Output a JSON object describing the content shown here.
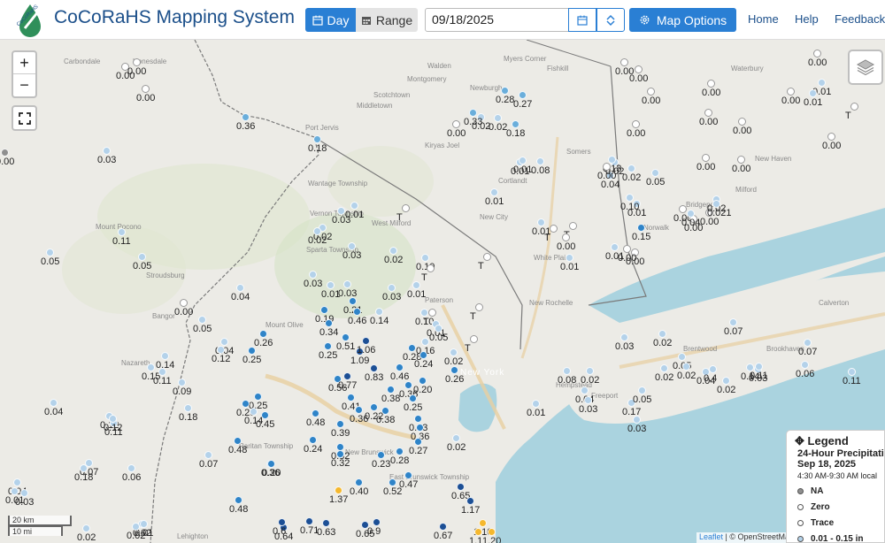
{
  "header": {
    "title": "CoCoRaHS Mapping System",
    "logo_text": "CoCoRaHS",
    "day_label": "Day",
    "range_label": "Range",
    "date_value": "09/18/2025",
    "map_options_label": "Map Options",
    "nav": [
      "Home",
      "Help",
      "Feedback"
    ]
  },
  "colors": {
    "accent": "#2a7fd4",
    "brand": "#1b4f8a",
    "na": "#8f8f8f",
    "zero": "#ffffff",
    "trace": "#ffffff",
    "light": "#b4d2ea",
    "low": "#6aaedb",
    "mid": "#2f84c8",
    "high": "#1c4f95",
    "heavy": "#f5b82e"
  },
  "map": {
    "zoom_in": "+",
    "zoom_out": "−",
    "scale_km": "20 km",
    "scale_mi": "10 mi",
    "attribution_leaflet": "Leaflet",
    "attribution_rest": " | © OpenStreetMap",
    "places": [
      "Carbondale",
      "Honesdale",
      "Walden",
      "Montgomery",
      "Middletown",
      "Scotchtown",
      "Port Jervis",
      "Kiryas Joel",
      "Newburgh",
      "Fishkill",
      "Myers Corner",
      "Waterbury",
      "New Haven",
      "Milford",
      "Wantage Township",
      "Vernon Township",
      "West Milford",
      "Sparta Township",
      "Cortlandt",
      "Somers",
      "New City",
      "White Plains",
      "Norwalk",
      "Stroudsburg",
      "Mount Olive",
      "Bangor",
      "Nazareth",
      "Paterson",
      "New Rochelle",
      "New York",
      "Raritan Township",
      "New Brunswick",
      "East Brunswick Township",
      "Brentwood",
      "Brookhaven",
      "Calverton",
      "Freeport",
      "Hempstead",
      "Mount Pocono",
      "Bridgeport",
      "Lehighton"
    ],
    "stations": [
      {
        "v": "0.00",
        "c": "na"
      },
      {
        "v": "0.00",
        "c": "zero"
      },
      {
        "v": "0.00",
        "c": "zero"
      },
      {
        "v": "0.00",
        "c": "zero"
      },
      {
        "v": "0.36",
        "c": "low"
      },
      {
        "v": "0.03",
        "c": "light"
      },
      {
        "v": "0.00",
        "c": "zero"
      },
      {
        "v": "0.18",
        "c": "low"
      },
      {
        "v": "0.02",
        "c": "light"
      },
      {
        "v": "0.00",
        "c": "zero"
      },
      {
        "v": "0.01",
        "c": "light"
      },
      {
        "v": "0.33",
        "c": "low"
      },
      {
        "v": "0.02",
        "c": "light"
      },
      {
        "v": "0.28",
        "c": "low"
      },
      {
        "v": "0.27",
        "c": "low"
      },
      {
        "v": "0.18",
        "c": "low"
      },
      {
        "v": "0.00",
        "c": "zero"
      },
      {
        "v": "0.00",
        "c": "zero"
      },
      {
        "v": "0.00",
        "c": "zero"
      },
      {
        "v": "0.00",
        "c": "zero"
      },
      {
        "v": "0.01",
        "c": "light"
      },
      {
        "v": "0.01",
        "c": "light"
      },
      {
        "v": "T",
        "c": "trace"
      },
      {
        "v": "0.00",
        "c": "zero"
      },
      {
        "v": "0.00",
        "c": "zero"
      },
      {
        "v": "0.00",
        "c": "zero"
      },
      {
        "v": "0.00",
        "c": "zero"
      },
      {
        "v": "0.00",
        "c": "zero"
      },
      {
        "v": "0.00",
        "c": "zero"
      },
      {
        "v": "0.01",
        "c": "light"
      },
      {
        "v": "0.08",
        "c": "light"
      },
      {
        "v": "0.04",
        "c": "light"
      },
      {
        "v": "0.02",
        "c": "light"
      },
      {
        "v": "0.02",
        "c": "light"
      },
      {
        "v": "0.01",
        "c": "light"
      },
      {
        "v": "0.00",
        "c": "zero"
      },
      {
        "v": "0.00",
        "c": "zero"
      },
      {
        "v": "0.00",
        "c": "zero"
      },
      {
        "v": "0.01",
        "c": "light"
      },
      {
        "v": "0.03",
        "c": "light"
      },
      {
        "v": "0.02",
        "c": "light"
      },
      {
        "v": "0.03",
        "c": "light"
      },
      {
        "v": "T",
        "c": "trace"
      },
      {
        "v": "0.01",
        "c": "light"
      },
      {
        "v": "0.10",
        "c": "light"
      },
      {
        "v": "0.02",
        "c": "light"
      },
      {
        "v": "0.021",
        "c": "light"
      },
      {
        "v": "0.00",
        "c": "zero"
      },
      {
        "v": "0.15",
        "c": "mid"
      },
      {
        "v": "0.01",
        "c": "light"
      },
      {
        "v": "T",
        "c": "trace"
      },
      {
        "v": "T",
        "c": "trace"
      },
      {
        "v": "0.01",
        "c": "light"
      },
      {
        "v": "0.00",
        "c": "zero"
      },
      {
        "v": "0.11",
        "c": "light"
      },
      {
        "v": "0.05",
        "c": "light"
      },
      {
        "v": "0.05",
        "c": "light"
      },
      {
        "v": "0.02",
        "c": "light"
      },
      {
        "v": "0.03",
        "c": "light"
      },
      {
        "v": "0.02",
        "c": "light"
      },
      {
        "v": "0.10",
        "c": "light"
      },
      {
        "v": "T",
        "c": "trace"
      },
      {
        "v": "T",
        "c": "trace"
      },
      {
        "v": "0.04",
        "c": "light"
      },
      {
        "v": "0.03",
        "c": "light"
      },
      {
        "v": "0.01",
        "c": "light"
      },
      {
        "v": "0.01",
        "c": "light"
      },
      {
        "v": "0.03",
        "c": "light"
      },
      {
        "v": "0.00",
        "c": "zero"
      },
      {
        "v": "0.05",
        "c": "light"
      },
      {
        "v": "0.19",
        "c": "mid"
      },
      {
        "v": "0.21",
        "c": "mid"
      },
      {
        "v": "0.46",
        "c": "mid"
      },
      {
        "v": "0.14",
        "c": "light"
      },
      {
        "v": "0.10",
        "c": "light"
      },
      {
        "v": "0.01",
        "c": "light"
      },
      {
        "v": "T",
        "c": "trace"
      },
      {
        "v": "T",
        "c": "trace"
      },
      {
        "v": "0.34",
        "c": "mid"
      },
      {
        "v": "0.26",
        "c": "mid"
      },
      {
        "v": "0.04",
        "c": "light"
      },
      {
        "v": "0.12",
        "c": "light"
      },
      {
        "v": "0.25",
        "c": "mid"
      },
      {
        "v": "0.51",
        "c": "mid"
      },
      {
        "v": "0.25",
        "c": "mid"
      },
      {
        "v": "1.09",
        "c": "high"
      },
      {
        "v": "1.06",
        "c": "high"
      },
      {
        "v": "0.16",
        "c": "light"
      },
      {
        "v": "0.28",
        "c": "mid"
      },
      {
        "v": "0.05",
        "c": "light"
      },
      {
        "v": "T",
        "c": "trace"
      },
      {
        "v": "0.14",
        "c": "light"
      },
      {
        "v": "0.15",
        "c": "light"
      },
      {
        "v": "0.11",
        "c": "light"
      },
      {
        "v": "0.09",
        "c": "light"
      },
      {
        "v": "0.56",
        "c": "mid"
      },
      {
        "v": "0.77",
        "c": "high"
      },
      {
        "v": "0.83",
        "c": "high"
      },
      {
        "v": "0.46",
        "c": "mid"
      },
      {
        "v": "0.24",
        "c": "mid"
      },
      {
        "v": "0.02",
        "c": "light"
      },
      {
        "v": "0.26",
        "c": "mid"
      },
      {
        "v": "0.20",
        "c": "mid"
      },
      {
        "v": "0.36",
        "c": "mid"
      },
      {
        "v": "0.41",
        "c": "mid"
      },
      {
        "v": "0.38",
        "c": "mid"
      },
      {
        "v": "0.25",
        "c": "mid"
      },
      {
        "v": "0.22",
        "c": "mid"
      },
      {
        "v": "0.36",
        "c": "mid"
      },
      {
        "v": "0.38",
        "c": "mid"
      },
      {
        "v": "0.23",
        "c": "mid"
      },
      {
        "v": "0.48",
        "c": "mid"
      },
      {
        "v": "0.39",
        "c": "mid"
      },
      {
        "v": "0.36",
        "c": "mid"
      },
      {
        "v": "0.32",
        "c": "mid"
      },
      {
        "v": "0.04",
        "c": "light"
      },
      {
        "v": "0.12",
        "c": "light"
      },
      {
        "v": "0.11",
        "c": "light"
      },
      {
        "v": "0.18",
        "c": "light"
      },
      {
        "v": "0.25",
        "c": "mid"
      },
      {
        "v": "0.28",
        "c": "mid"
      },
      {
        "v": "0.14",
        "c": "light"
      },
      {
        "v": "0.45",
        "c": "mid"
      },
      {
        "v": "0.48",
        "c": "mid"
      },
      {
        "v": "0.24",
        "c": "mid"
      },
      {
        "v": "0.32",
        "c": "mid"
      },
      {
        "v": "0.27",
        "c": "mid"
      },
      {
        "v": "0.28",
        "c": "mid"
      },
      {
        "v": "0.23",
        "c": "mid"
      },
      {
        "v": "0.07",
        "c": "light"
      },
      {
        "v": "0.36",
        "c": "mid"
      },
      {
        "v": "0.20",
        "c": "mid"
      },
      {
        "v": "0.47",
        "c": "mid"
      },
      {
        "v": "0.40",
        "c": "mid"
      },
      {
        "v": "0.52",
        "c": "mid"
      },
      {
        "v": "1.37",
        "c": "heavy"
      },
      {
        "v": "0.65",
        "c": "high"
      },
      {
        "v": "0.67",
        "c": "high"
      },
      {
        "v": "1.17",
        "c": "high"
      },
      {
        "v": "1.10",
        "c": "heavy"
      },
      {
        "v": "1.20",
        "c": "heavy"
      },
      {
        "v": "1.1",
        "c": "heavy"
      },
      {
        "v": "0.48",
        "c": "mid"
      },
      {
        "v": "0.64",
        "c": "high"
      },
      {
        "v": "0.6",
        "c": "high"
      },
      {
        "v": "0.71",
        "c": "high"
      },
      {
        "v": "0.63",
        "c": "high"
      },
      {
        "v": "0.65",
        "c": "high"
      },
      {
        "v": "0.9",
        "c": "high"
      },
      {
        "v": "0.07",
        "c": "light"
      },
      {
        "v": "0.18",
        "c": "light"
      },
      {
        "v": "0.06",
        "c": "light"
      },
      {
        "v": "0.04",
        "c": "light"
      },
      {
        "v": "0.03",
        "c": "light"
      },
      {
        "v": "0.02",
        "c": "light"
      },
      {
        "v": "0.01",
        "c": "light"
      },
      {
        "v": "0.01",
        "c": "light"
      },
      {
        "v": "0.02",
        "c": "light"
      },
      {
        "v": "0.02",
        "c": "light"
      },
      {
        "v": "0.12",
        "c": "light"
      },
      {
        "v": "0.01",
        "c": "light"
      },
      {
        "v": "0.04",
        "c": "light"
      },
      {
        "v": "0.03",
        "c": "light"
      },
      {
        "v": "0.17",
        "c": "light"
      },
      {
        "v": "0.05",
        "c": "light"
      },
      {
        "v": "0.02",
        "c": "light"
      },
      {
        "v": "0.08",
        "c": "light"
      },
      {
        "v": "0.02",
        "c": "light"
      },
      {
        "v": "0.02",
        "c": "light"
      },
      {
        "v": "0.04",
        "c": "light"
      },
      {
        "v": "0.05",
        "c": "light"
      },
      {
        "v": "0.4",
        "c": "light"
      },
      {
        "v": "0.03",
        "c": "light"
      },
      {
        "v": "0.06",
        "c": "light"
      },
      {
        "v": "0.07",
        "c": "light"
      },
      {
        "v": "0.07",
        "c": "light"
      },
      {
        "v": "0.11",
        "c": "light"
      },
      {
        "v": "0.14",
        "c": "light"
      },
      {
        "v": "0.11",
        "c": "light"
      },
      {
        "v": "0.02",
        "c": "light"
      },
      {
        "v": "0.03",
        "c": "light"
      },
      {
        "v": "0.02",
        "c": "light"
      },
      {
        "v": "0.03",
        "c": "light"
      },
      {
        "v": "0.04",
        "c": "light"
      },
      {
        "v": "0.00",
        "c": "zero"
      },
      {
        "v": "0.05",
        "c": "light"
      },
      {
        "v": "0.13",
        "c": "light"
      },
      {
        "v": "0.00",
        "c": "zero"
      },
      {
        "v": "0.00",
        "c": "zero"
      },
      {
        "v": "0.01",
        "c": "light"
      },
      {
        "v": "0.02",
        "c": "light"
      },
      {
        "v": "0.01",
        "c": "light"
      },
      {
        "v": "0.01",
        "c": "light"
      },
      {
        "v": "0.02",
        "c": "light"
      },
      {
        "v": "0.32",
        "c": "mid"
      }
    ]
  },
  "legend": {
    "title": "Legend",
    "subtitle": "24-Hour Precipitation",
    "date": "Sep 18, 2025",
    "time": "4:30 AM-9:30 AM local",
    "items": [
      {
        "label": "NA",
        "color": "#8f8f8f"
      },
      {
        "label": "Zero",
        "color": "#ffffff"
      },
      {
        "label": "Trace",
        "color": "#ffffff"
      },
      {
        "label": "0.01 - 0.15 in",
        "color": "#b4d2ea"
      }
    ]
  }
}
